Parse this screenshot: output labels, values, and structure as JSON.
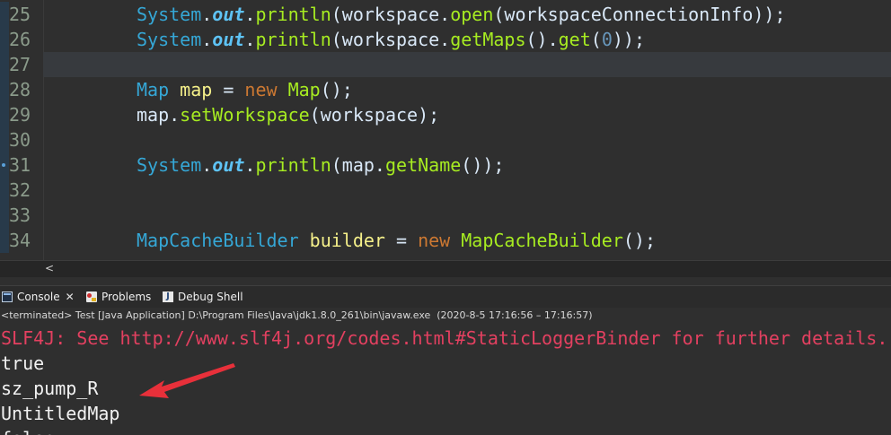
{
  "editor": {
    "lines": [
      {
        "num": "25",
        "tokens": [
          {
            "t": "System",
            "k": "cls"
          },
          {
            "t": ".",
            "k": "plain"
          },
          {
            "t": "out",
            "k": "fld"
          },
          {
            "t": ".",
            "k": "plain"
          },
          {
            "t": "println",
            "k": "mth"
          },
          {
            "t": "(workspace.",
            "k": "plain"
          },
          {
            "t": "open",
            "k": "mth"
          },
          {
            "t": "(workspaceConnectionInfo));",
            "k": "plain"
          }
        ]
      },
      {
        "num": "26",
        "tokens": [
          {
            "t": "System",
            "k": "cls"
          },
          {
            "t": ".",
            "k": "plain"
          },
          {
            "t": "out",
            "k": "fld"
          },
          {
            "t": ".",
            "k": "plain"
          },
          {
            "t": "println",
            "k": "mth"
          },
          {
            "t": "(workspace.",
            "k": "plain"
          },
          {
            "t": "getMaps",
            "k": "mth"
          },
          {
            "t": "().",
            "k": "plain"
          },
          {
            "t": "get",
            "k": "mth"
          },
          {
            "t": "(",
            "k": "plain"
          },
          {
            "t": "0",
            "k": "num"
          },
          {
            "t": "));",
            "k": "plain"
          }
        ]
      },
      {
        "num": "27",
        "tokens": [],
        "current": true
      },
      {
        "num": "28",
        "tokens": [
          {
            "t": "Map",
            "k": "cls"
          },
          {
            "t": " ",
            "k": "plain"
          },
          {
            "t": "map",
            "k": "var"
          },
          {
            "t": " = ",
            "k": "plain"
          },
          {
            "t": "new",
            "k": "kw"
          },
          {
            "t": " ",
            "k": "plain"
          },
          {
            "t": "Map",
            "k": "mth"
          },
          {
            "t": "();",
            "k": "plain"
          }
        ]
      },
      {
        "num": "29",
        "tokens": [
          {
            "t": "map.",
            "k": "plain"
          },
          {
            "t": "setWorkspace",
            "k": "mth"
          },
          {
            "t": "(workspace);",
            "k": "plain"
          }
        ]
      },
      {
        "num": "30",
        "tokens": []
      },
      {
        "num": "31",
        "marker": true,
        "tokens": [
          {
            "t": "System",
            "k": "cls"
          },
          {
            "t": ".",
            "k": "plain"
          },
          {
            "t": "out",
            "k": "fld"
          },
          {
            "t": ".",
            "k": "plain"
          },
          {
            "t": "println",
            "k": "mth"
          },
          {
            "t": "(map.",
            "k": "plain"
          },
          {
            "t": "getName",
            "k": "mth"
          },
          {
            "t": "());",
            "k": "plain"
          }
        ]
      },
      {
        "num": "32",
        "tokens": []
      },
      {
        "num": "33",
        "tokens": []
      },
      {
        "num": "34",
        "tokens": [
          {
            "t": "MapCacheBuilder",
            "k": "cls"
          },
          {
            "t": " ",
            "k": "plain"
          },
          {
            "t": "builder",
            "k": "var"
          },
          {
            "t": " = ",
            "k": "plain"
          },
          {
            "t": "new",
            "k": "kw"
          },
          {
            "t": " ",
            "k": "plain"
          },
          {
            "t": "MapCacheBuilder",
            "k": "mth"
          },
          {
            "t": "();",
            "k": "plain"
          }
        ]
      }
    ],
    "scroll_left_glyph": "<"
  },
  "tabs": {
    "console_label": "Console",
    "console_close": "✕",
    "problems_label": "Problems",
    "debug_label": "Debug Shell",
    "debug_glyph": "J"
  },
  "status": "<terminated> Test [Java Application] D:\\Program Files\\Java\\jdk1.8.0_261\\bin\\javaw.exe  (2020-8-5 17:16:56 – 17:16:57)",
  "console": {
    "lines": [
      {
        "text": "SLF4J: See http://www.slf4j.org/codes.html#StaticLoggerBinder for further details.",
        "err": true
      },
      {
        "text": "true",
        "err": false
      },
      {
        "text": "sz_pump_R",
        "err": false
      },
      {
        "text": "UntitledMap",
        "err": false
      },
      {
        "text": "false",
        "err": false
      }
    ]
  },
  "colors": {
    "annotation_arrow": "#e8303a"
  }
}
